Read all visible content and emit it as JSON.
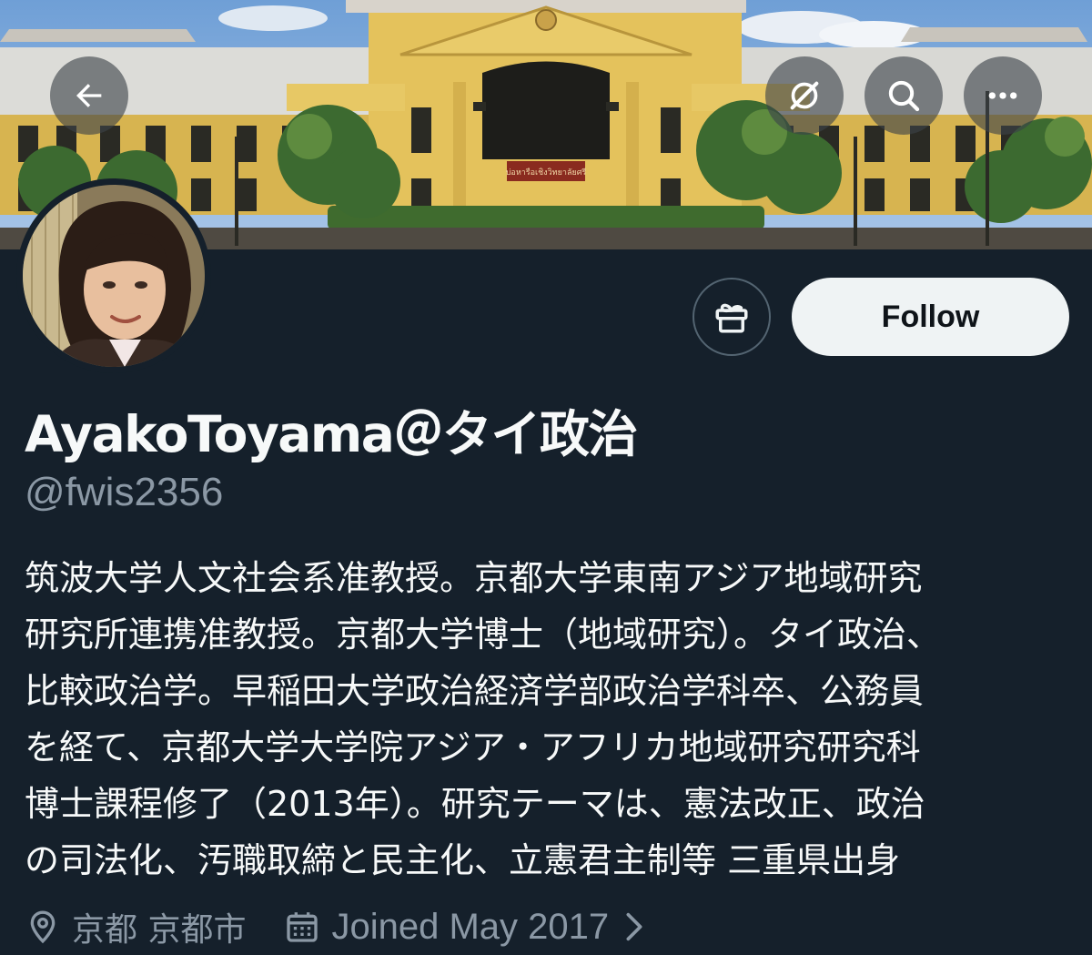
{
  "header": {
    "back_icon": "arrow-left-icon",
    "grok_icon": "grok-icon",
    "search_icon": "search-icon",
    "more_icon": "more-horizontal-icon"
  },
  "banner": {
    "sign_text": "บ่อหารือเชิงวิทยาลัยศรี"
  },
  "profile": {
    "display_name": "AyakoToyama＠タイ政治",
    "handle": "@fwis2356",
    "bio_lines": [
      "筑波大学人文社会系准教授。京都大学東南アジア地域研究",
      "研究所連携准教授。京都大学博士（地域研究）。タイ政治、",
      "比較政治学。早稲田大学政治経済学部政治学科卒、公務員",
      "を経て、京都大学大学院アジア・アフリカ地域研究研究科",
      "博士課程修了（2013年）。研究テーマは、憲法改正、政治",
      "の司法化、汚職取締と民主化、立憲君主制等 三重県出身"
    ],
    "location": "京都 京都市",
    "joined": "Joined May 2017"
  },
  "actions": {
    "gift_icon": "gift-icon",
    "follow_label": "Follow"
  },
  "colors": {
    "background": "#15202b",
    "text_primary": "#f7f9f9",
    "text_secondary": "#8b98a5",
    "follow_bg": "#eff3f4",
    "follow_text": "#0f1419",
    "outline": "#536471"
  }
}
